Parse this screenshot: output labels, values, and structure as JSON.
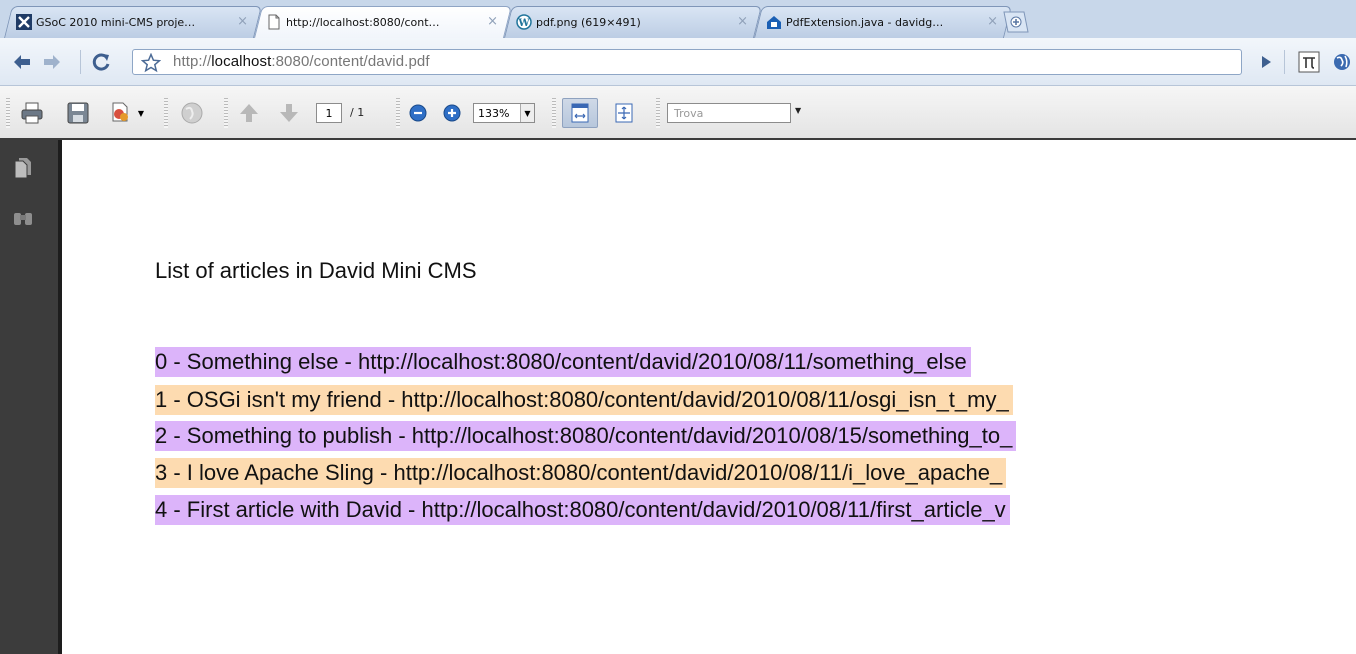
{
  "tabs": [
    {
      "title": "GSoC 2010 mini-CMS proje…",
      "favicon": "gsoc-icon",
      "active": false
    },
    {
      "title": "http://localhost:8080/cont…",
      "favicon": "page-icon",
      "active": true
    },
    {
      "title": "pdf.png (619×491)",
      "favicon": "wordpress-icon",
      "active": false
    },
    {
      "title": "PdfExtension.java - davidg…",
      "favicon": "github-icon",
      "active": false
    }
  ],
  "close_glyph": "×",
  "address": {
    "prefix": "http://",
    "host": "localhost",
    "path": ":8080/content/david.pdf"
  },
  "pdf_toolbar": {
    "page_current": "1",
    "page_total": "/ 1",
    "zoom": "133%",
    "find_placeholder": "Trova"
  },
  "document": {
    "title": "List of articles in David Mini CMS",
    "articles": [
      {
        "text": "0 - Something else - http://localhost:8080/content/david/2010/08/11/something_else",
        "highlight": "#dcb4fa"
      },
      {
        "text": "1 - OSGi isn't my friend - http://localhost:8080/content/david/2010/08/11/osgi_isn_t_my_",
        "highlight": "#fddbb0"
      },
      {
        "text": "2 - Something to publish - http://localhost:8080/content/david/2010/08/15/something_to_",
        "highlight": "#dcb4fa"
      },
      {
        "text": "3 - I love Apache Sling - http://localhost:8080/content/david/2010/08/11/i_love_apache_",
        "highlight": "#fddbb0"
      },
      {
        "text": "4 - First article with David - http://localhost:8080/content/david/2010/08/11/first_article_v",
        "highlight": "#dcb4fa"
      }
    ]
  },
  "colors": {
    "tabstrip": "#c8d7ea",
    "sidebar": "#3c3c3c",
    "highlight_purple": "#dcb4fa",
    "highlight_orange": "#fddbb0"
  }
}
